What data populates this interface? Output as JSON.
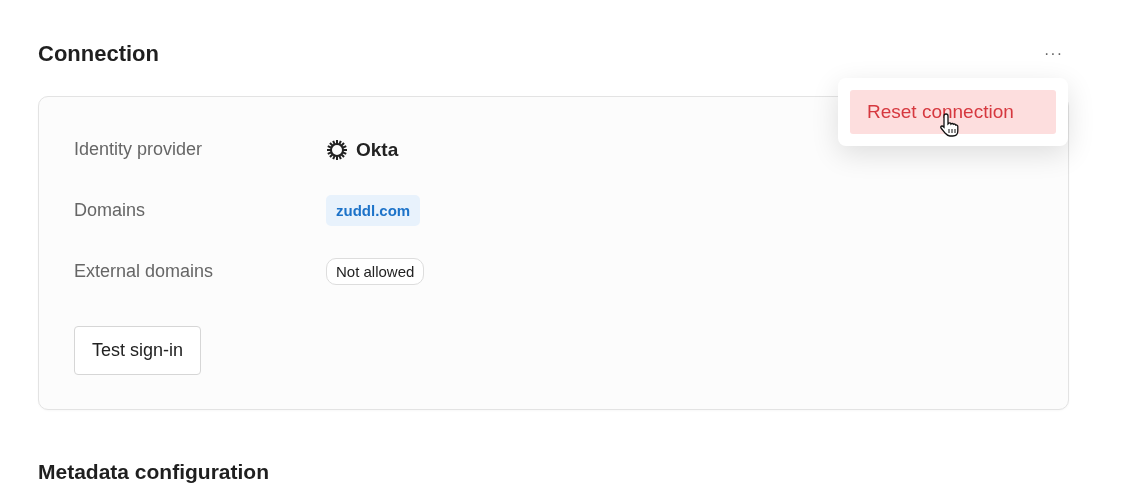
{
  "section_title": "Connection",
  "more_menu": {
    "label": "···",
    "open": true,
    "items": [
      {
        "label": "Reset connection",
        "kind": "danger",
        "hovered": true
      }
    ]
  },
  "fields": [
    {
      "label": "Identity provider",
      "kind": "provider",
      "value": "Okta"
    },
    {
      "label": "Domains",
      "kind": "tag",
      "value": "zuddl.com"
    },
    {
      "label": "External domains",
      "kind": "pill",
      "value": "Not allowed"
    }
  ],
  "test_button": "Test sign-in",
  "next_section_title": "Metadata configuration"
}
